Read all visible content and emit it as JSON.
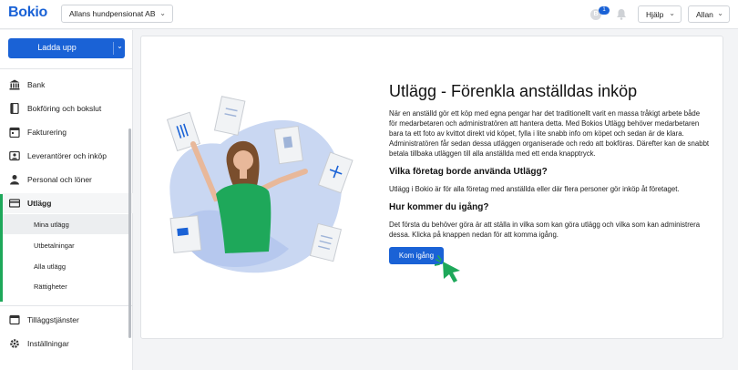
{
  "header": {
    "logo": "Bokio",
    "company": "Allans hundpensionat AB",
    "notification_count": "1",
    "coin_symbol": "B",
    "help_label": "Hjälp",
    "user_label": "Allan"
  },
  "sidebar": {
    "upload_label": "Ladda upp",
    "items": [
      {
        "label": "Bank",
        "icon": "bank-icon"
      },
      {
        "label": "Bokföring och bokslut",
        "icon": "book-icon"
      },
      {
        "label": "Fakturering",
        "icon": "calendar-icon"
      },
      {
        "label": "Leverantörer och inköp",
        "icon": "supplier-icon"
      },
      {
        "label": "Personal och löner",
        "icon": "person-icon"
      },
      {
        "label": "Utlägg",
        "icon": "card-icon"
      }
    ],
    "sub_items": [
      {
        "label": "Mina utlägg"
      },
      {
        "label": "Utbetalningar"
      },
      {
        "label": "Alla utlägg"
      },
      {
        "label": "Rättigheter"
      }
    ],
    "bottom_items": [
      {
        "label": "Tilläggstjänster",
        "icon": "addon-icon"
      },
      {
        "label": "Inställningar",
        "icon": "gear-icon"
      }
    ]
  },
  "main": {
    "title": "Utlägg - Förenkla anställdas inköp",
    "intro": "När en anställd gör ett köp med egna pengar har det traditionellt varit en massa tråkigt arbete både för medarbetaren och administratören att hantera detta. Med Bokios Utlägg behöver medarbetaren bara ta ett foto av kvittot direkt vid köpet, fylla i lite snabb info om köpet och sedan är de klara. Administratören får sedan dessa utläggen organiserade och redo att bokföras. Därefter kan de snabbt betala tillbaka utläggen till alla anställda med ett enda knapptryck.",
    "q1": "Vilka företag borde använda Utlägg?",
    "a1": "Utlägg i Bokio är för alla företag med anställda eller där flera personer gör inköp åt företaget.",
    "q2": "Hur kommer du igång?",
    "a2": "Det första du behöver göra är att ställa in vilka som kan göra utlägg och vilka som kan administrera dessa. Klicka på knappen nedan för att komma igång.",
    "cta_label": "Kom igång"
  },
  "colors": {
    "brand_blue": "#1a62d6",
    "accent_green": "#1ea85a"
  }
}
